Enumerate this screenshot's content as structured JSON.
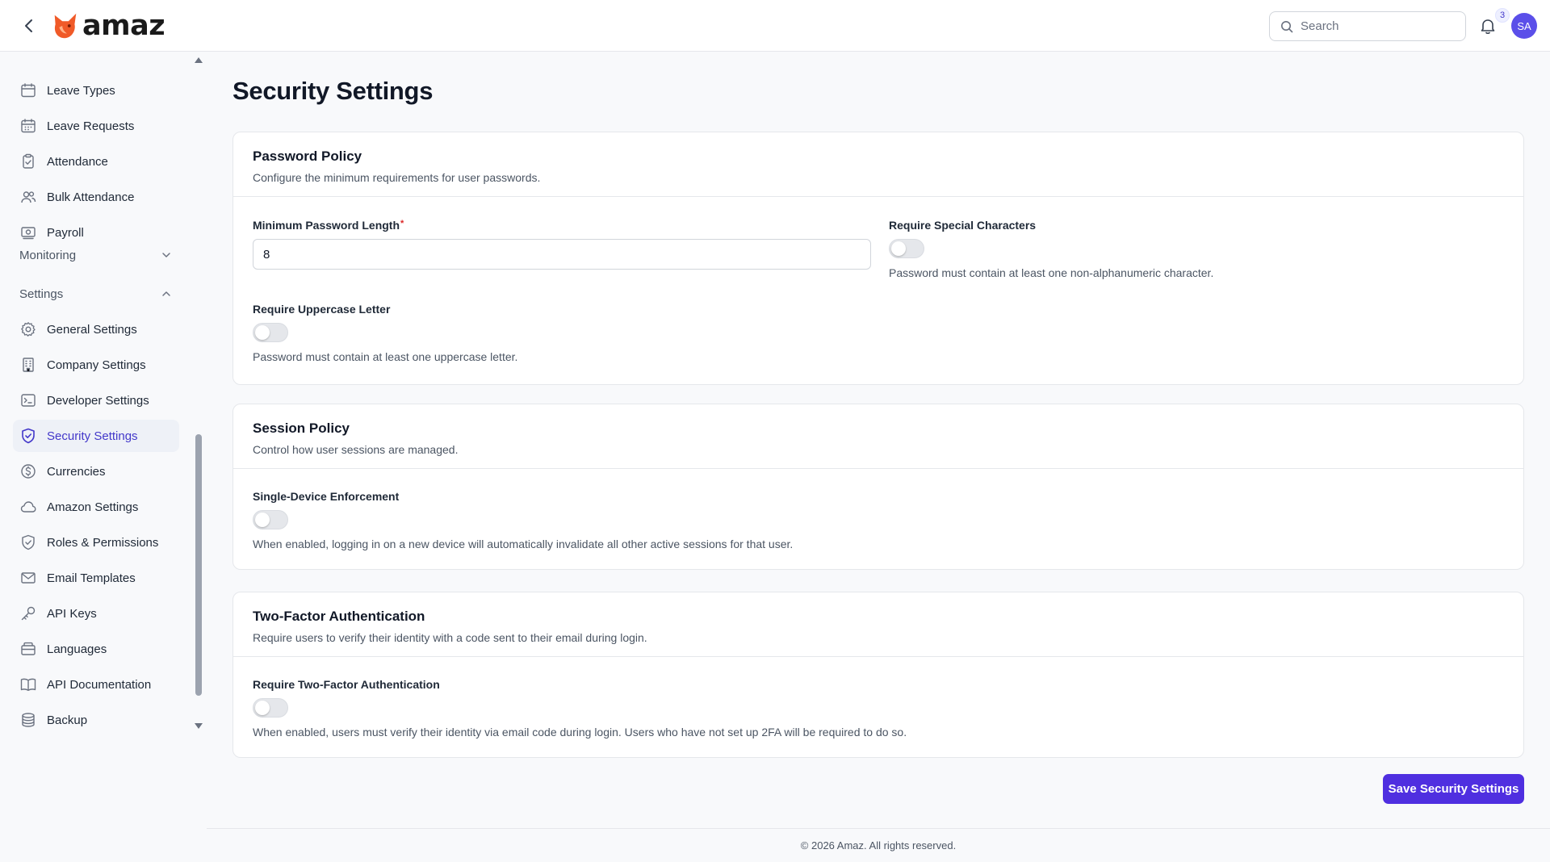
{
  "header": {
    "logo_text": "amaz",
    "search": {
      "placeholder": "Search",
      "value": ""
    },
    "notification_count": "3",
    "avatar_initials": "SA",
    "brand_color": "#f05a28"
  },
  "sidebar": {
    "items_top": [
      {
        "label": "Leave Types",
        "icon": "calendar-icon"
      },
      {
        "label": "Leave Requests",
        "icon": "calendar-grid-icon"
      },
      {
        "label": "Attendance",
        "icon": "clipboard-check-icon"
      },
      {
        "label": "Bulk Attendance",
        "icon": "users-icon"
      },
      {
        "label": "Payroll",
        "icon": "payroll-icon"
      }
    ],
    "sections": [
      {
        "label": "Monitoring",
        "expanded": false
      },
      {
        "label": "Settings",
        "expanded": true
      }
    ],
    "settings_items": [
      {
        "label": "General Settings",
        "icon": "gear-icon"
      },
      {
        "label": "Company Settings",
        "icon": "building-icon"
      },
      {
        "label": "Developer Settings",
        "icon": "terminal-icon"
      },
      {
        "label": "Security Settings",
        "icon": "shield-check-icon",
        "active": true
      },
      {
        "label": "Currencies",
        "icon": "dollar-circle-icon"
      },
      {
        "label": "Amazon Settings",
        "icon": "cloud-icon"
      },
      {
        "label": "Roles & Permissions",
        "icon": "shield-icon"
      },
      {
        "label": "Email Templates",
        "icon": "mail-icon"
      },
      {
        "label": "API Keys",
        "icon": "key-icon"
      },
      {
        "label": "Languages",
        "icon": "languages-icon"
      },
      {
        "label": "API Documentation",
        "icon": "book-icon"
      },
      {
        "label": "Backup",
        "icon": "database-icon"
      }
    ]
  },
  "page": {
    "title": "Security Settings",
    "password_policy": {
      "title": "Password Policy",
      "description": "Configure the minimum requirements for user passwords.",
      "min_length_label": "Minimum Password Length",
      "min_length_required_mark": "*",
      "min_length_value": "8",
      "special_label": "Require Special Characters",
      "special_help": "Password must contain at least one non-alphanumeric character.",
      "special_enabled": false,
      "uppercase_label": "Require Uppercase Letter",
      "uppercase_help": "Password must contain at least one uppercase letter.",
      "uppercase_enabled": false
    },
    "session_policy": {
      "title": "Session Policy",
      "description": "Control how user sessions are managed.",
      "single_device_label": "Single-Device Enforcement",
      "single_device_help": "When enabled, logging in on a new device will automatically invalidate all other active sessions for that user.",
      "single_device_enabled": false
    },
    "two_factor": {
      "title": "Two-Factor Authentication",
      "description": "Require users to verify their identity with a code sent to their email during login.",
      "require_label": "Require Two-Factor Authentication",
      "require_help": "When enabled, users must verify their identity via email code during login. Users who have not set up 2FA will be required to do so.",
      "require_enabled": false
    },
    "save_label": "Save Security Settings",
    "footer": "© 2026 Amaz. All rights reserved.",
    "accent_color": "#4f2fe0"
  }
}
